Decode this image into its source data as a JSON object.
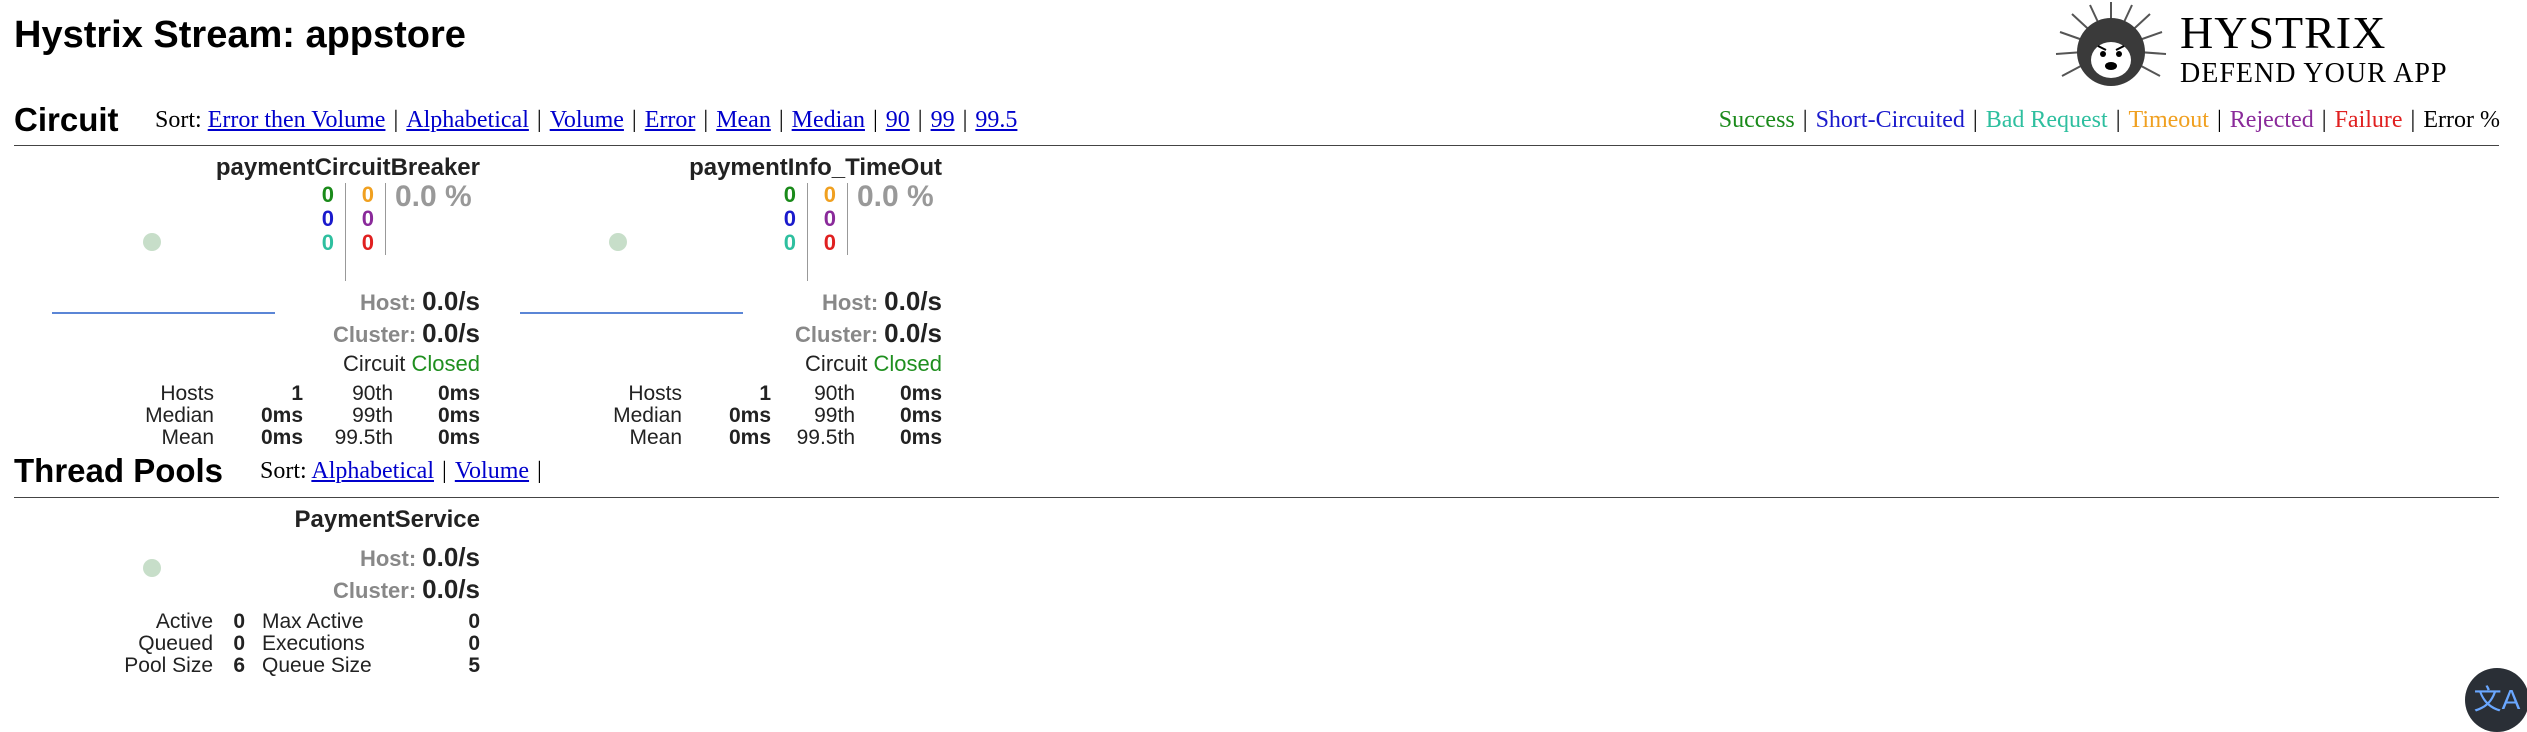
{
  "page": {
    "title": "Hystrix Stream: appstore"
  },
  "logo": {
    "line1": "Hystrix",
    "line2": "Defend Your App",
    "icon": "hystrix-porcupine-logo"
  },
  "circuit": {
    "title": "Circuit",
    "sort_label": "Sort:",
    "sort_links": [
      "Error then Volume",
      "Alphabetical",
      "Volume",
      "Error",
      "Mean",
      "Median",
      "90",
      "99",
      "99.5"
    ],
    "legend": [
      {
        "label": "Success",
        "color": "#1a8a1a"
      },
      {
        "label": "Short-Circuited",
        "color": "#1a1acc"
      },
      {
        "label": "Bad Request",
        "color": "#2ebf9f"
      },
      {
        "label": "Timeout",
        "color": "#f0a020"
      },
      {
        "label": "Rejected",
        "color": "#8a2a9a"
      },
      {
        "label": "Failure",
        "color": "#e02020"
      },
      {
        "label": "Error %",
        "color": "#000000"
      }
    ],
    "monitors": [
      {
        "name": "paymentCircuitBreaker",
        "success": "0",
        "short_circuited": "0",
        "bad_request": "0",
        "timeout": "0",
        "rejected": "0",
        "failure": "0",
        "error_pct": "0.0 %",
        "host_label": "Host:",
        "host_rate": "0.0/s",
        "cluster_label": "Cluster:",
        "cluster_rate": "0.0/s",
        "circuit_label": "Circuit",
        "circuit_status": "Closed",
        "stats": {
          "hosts_label": "Hosts",
          "hosts": "1",
          "median_label": "Median",
          "median": "0ms",
          "mean_label": "Mean",
          "mean": "0ms",
          "p90_label": "90th",
          "p90": "0ms",
          "p99_label": "99th",
          "p99": "0ms",
          "p995_label": "99.5th",
          "p995": "0ms"
        }
      },
      {
        "name": "paymentInfo_TimeOut",
        "success": "0",
        "short_circuited": "0",
        "bad_request": "0",
        "timeout": "0",
        "rejected": "0",
        "failure": "0",
        "error_pct": "0.0 %",
        "host_label": "Host:",
        "host_rate": "0.0/s",
        "cluster_label": "Cluster:",
        "cluster_rate": "0.0/s",
        "circuit_label": "Circuit",
        "circuit_status": "Closed",
        "stats": {
          "hosts_label": "Hosts",
          "hosts": "1",
          "median_label": "Median",
          "median": "0ms",
          "mean_label": "Mean",
          "mean": "0ms",
          "p90_label": "90th",
          "p90": "0ms",
          "p99_label": "99th",
          "p99": "0ms",
          "p995_label": "99.5th",
          "p995": "0ms"
        }
      }
    ]
  },
  "thread_pools": {
    "title": "Thread Pools",
    "sort_label": "Sort:",
    "sort_links": [
      "Alphabetical",
      "Volume"
    ],
    "pools": [
      {
        "name": "PaymentService",
        "host_label": "Host:",
        "host_rate": "0.0/s",
        "cluster_label": "Cluster:",
        "cluster_rate": "0.0/s",
        "active_label": "Active",
        "active": "0",
        "queued_label": "Queued",
        "queued": "0",
        "pool_size_label": "Pool Size",
        "pool_size": "6",
        "max_active_label": "Max Active",
        "max_active": "0",
        "executions_label": "Executions",
        "executions": "0",
        "queue_size_label": "Queue Size",
        "queue_size": "5"
      }
    ]
  },
  "translate_button": {
    "icon": "translate-icon",
    "glyph": "文A"
  }
}
